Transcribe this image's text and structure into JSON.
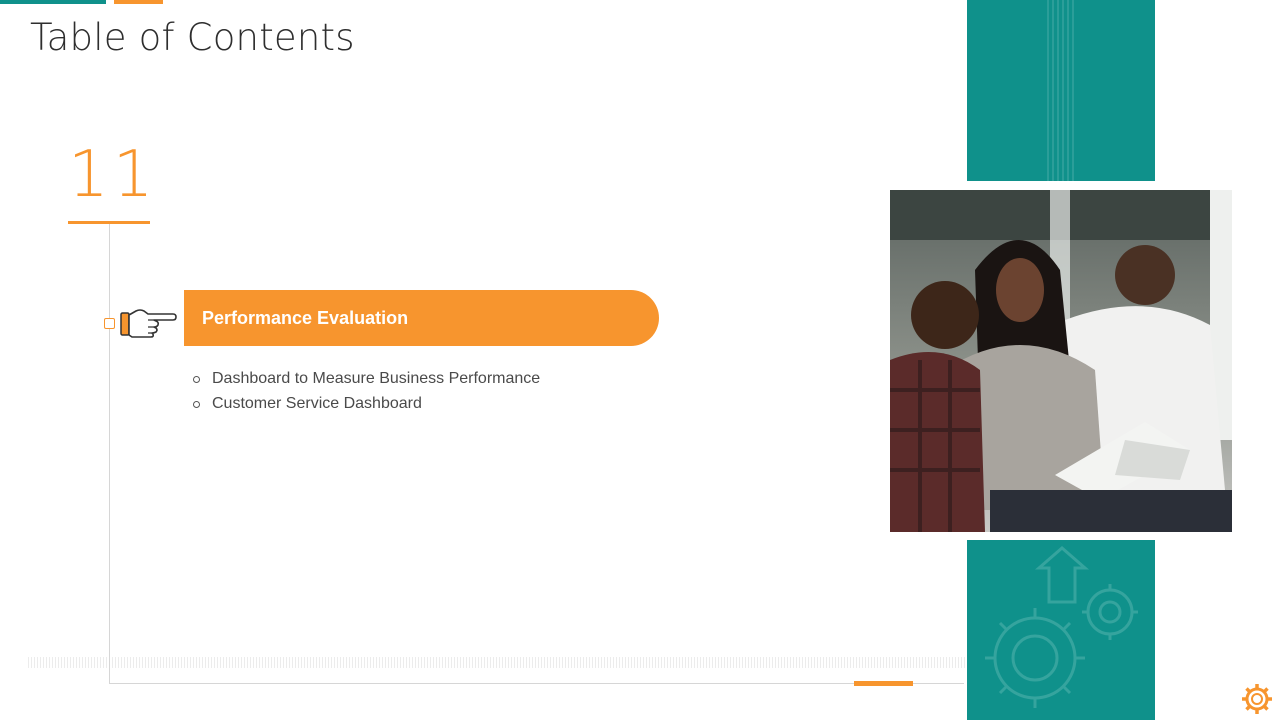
{
  "slide": {
    "title": "Table of Contents",
    "section_number": "11",
    "section": {
      "heading": "Performance Evaluation",
      "items": [
        "Dashboard to Measure Business Performance",
        "Customer Service Dashboard"
      ]
    }
  },
  "icons": {
    "pointer": "pointing-hand-icon",
    "gears": "gears-icon",
    "arrow": "up-arrow-icon",
    "corner": "gear-icon"
  },
  "colors": {
    "accent_orange": "#f7952e",
    "accent_teal": "#0f918b",
    "title_text": "#2e2e2e",
    "body_text": "#4a4a4a"
  }
}
